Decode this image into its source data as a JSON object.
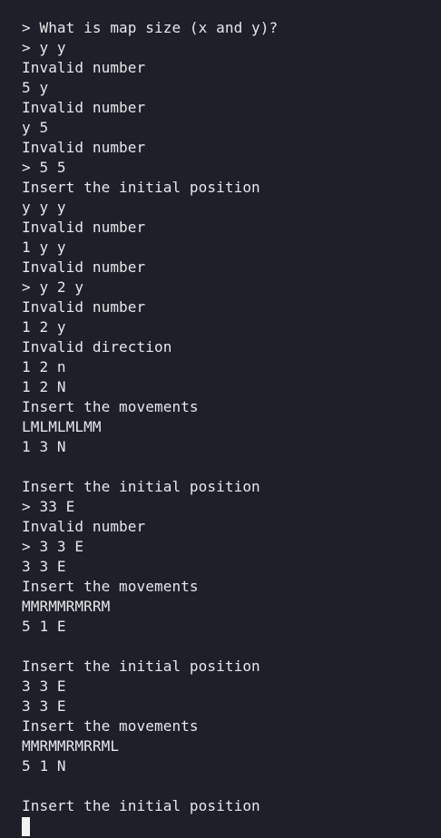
{
  "terminal": {
    "lines": [
      "> What is map size (x and y)?",
      "> y y",
      "Invalid number",
      "5 y",
      "Invalid number",
      "y 5",
      "Invalid number",
      "> 5 5",
      "Insert the initial position",
      "y y y",
      "Invalid number",
      "1 y y",
      "Invalid number",
      "> y 2 y",
      "Invalid number",
      "1 2 y",
      "Invalid direction",
      "1 2 n",
      "1 2 N",
      "Insert the movements",
      "LMLMLMLMM",
      "1 3 N",
      "",
      "Insert the initial position",
      "> 33 E",
      "Invalid number",
      "> 3 3 E",
      "3 3 E",
      "Insert the movements",
      "MMRMMRMRRM",
      "5 1 E",
      "",
      "Insert the initial position",
      "3 3 E",
      "3 3 E",
      "Insert the movements",
      "MMRMMRMRRML",
      "5 1 N",
      "",
      "Insert the initial position"
    ]
  }
}
